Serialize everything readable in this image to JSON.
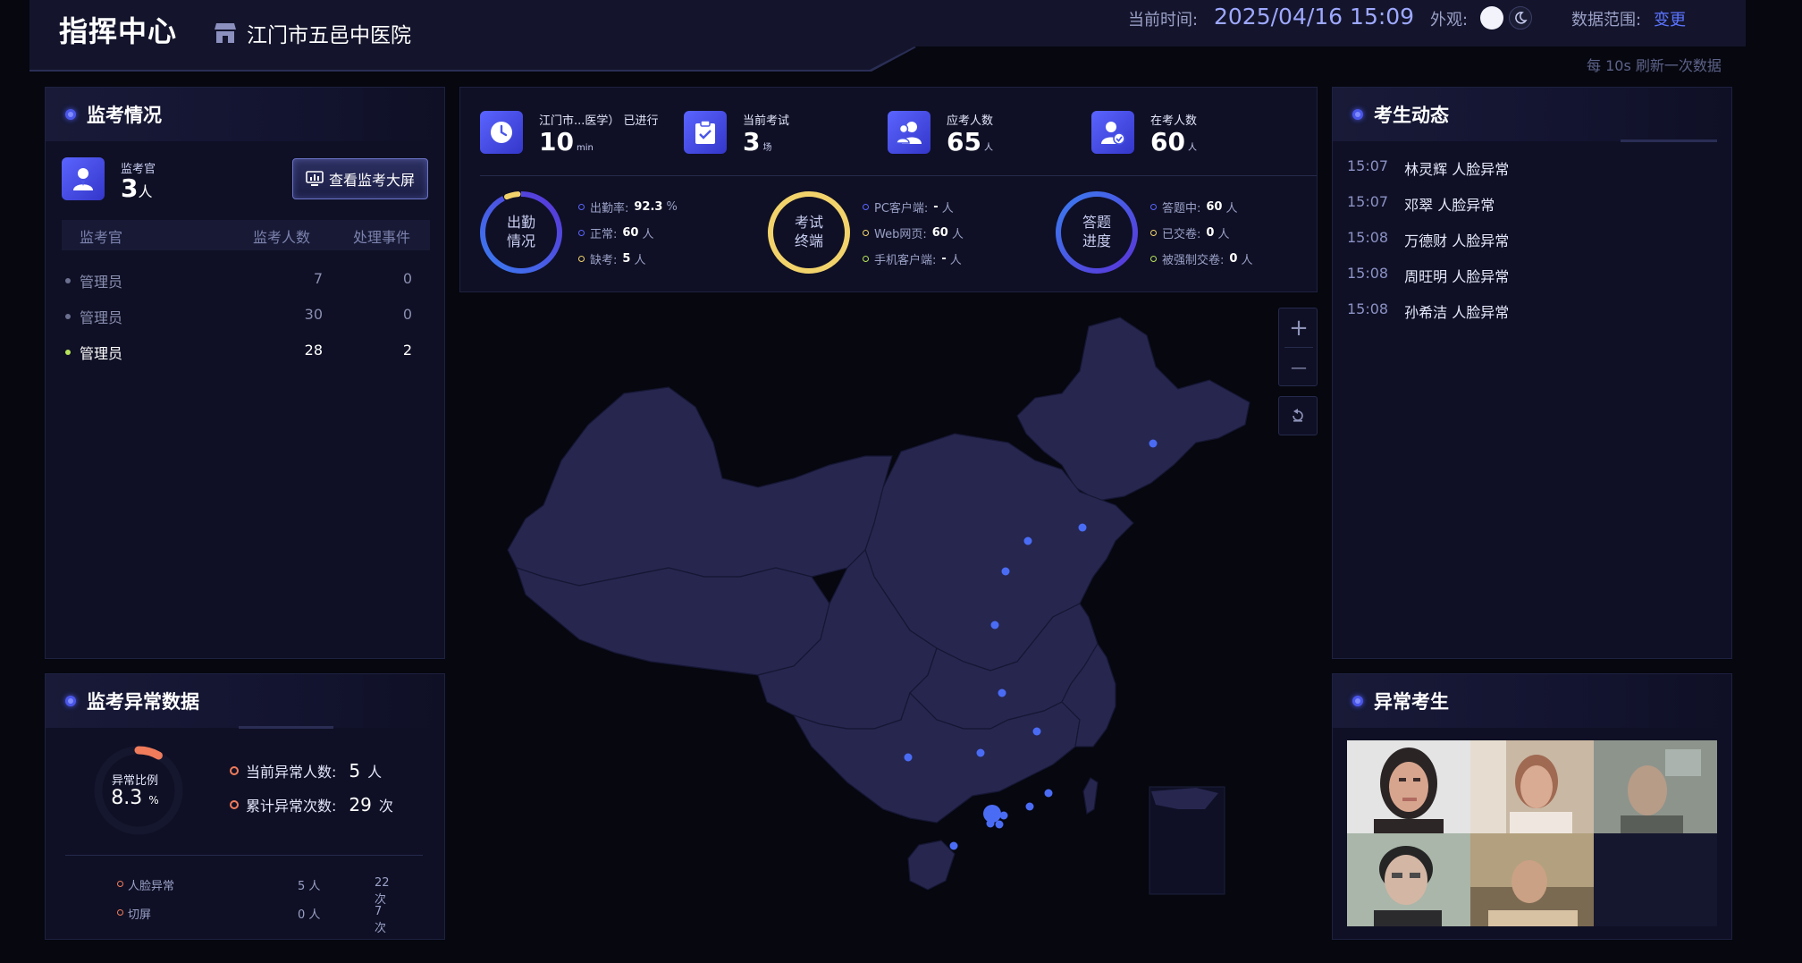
{
  "header": {
    "title": "指挥中心",
    "org_name": "江门市五邑中医院",
    "time_label": "当前时间:",
    "time_value": "2025/04/16 15:09",
    "appearance_label": "外观:",
    "data_scope_label": "数据范围:",
    "data_scope_link": "变更",
    "refresh_note": "每 10s 刷新一次数据",
    "icons": [
      "store-icon",
      "sun-icon",
      "moon-icon"
    ]
  },
  "supervision": {
    "title": "监考情况",
    "supervisor_label": "监考官",
    "supervisor_count": "3",
    "supervisor_unit": "人",
    "big_screen_button": "查看监考大屏",
    "columns": [
      "监考官",
      "监考人数",
      "处理事件"
    ],
    "rows": [
      {
        "name": "管理员",
        "count": "7",
        "events": "0",
        "active": false
      },
      {
        "name": "管理员",
        "count": "30",
        "events": "0",
        "active": false
      },
      {
        "name": "管理员",
        "count": "28",
        "events": "2",
        "active": true
      }
    ]
  },
  "center_stats": {
    "items": [
      {
        "label": "江门市...医学）  已进行",
        "value": "10",
        "unit": "min",
        "icon": "clock-icon"
      },
      {
        "label": "当前考试",
        "value": "3",
        "unit": "场",
        "icon": "clipboard-check-icon"
      },
      {
        "label": "应考人数",
        "value": "65",
        "unit": "人",
        "icon": "users-icon"
      },
      {
        "label": "在考人数",
        "value": "60",
        "unit": "人",
        "icon": "user-check-icon"
      }
    ],
    "attendance": {
      "label_line1": "出勤",
      "label_line2": "情况",
      "rate_label": "出勤率:",
      "rate_value": "92.3",
      "rate_unit": "%",
      "rate_fraction": 0.923,
      "normal_label": "正常:",
      "normal_value": "60",
      "normal_unit": "人",
      "absent_label": "缺考:",
      "absent_value": "5",
      "absent_unit": "人",
      "colors": {
        "main": "#4a56e8",
        "accent": "#f2d36b"
      }
    },
    "terminal": {
      "label_line1": "考试",
      "label_line2": "终端",
      "pc_label": "PC客户端:",
      "pc_value": "-",
      "pc_unit": "人",
      "web_label": "Web网页:",
      "web_value": "60",
      "web_unit": "人",
      "mobile_label": "手机客户端:",
      "mobile_value": "-",
      "mobile_unit": "人",
      "colors": {
        "main": "#f2d36b"
      }
    },
    "progress": {
      "label_line1": "答题",
      "label_line2": "进度",
      "answering_label": "答题中:",
      "answering_value": "60",
      "answering_unit": "人",
      "submitted_label": "已交卷:",
      "submitted_value": "0",
      "submitted_unit": "人",
      "forced_label": "被强制交卷:",
      "forced_value": "0",
      "forced_unit": "人",
      "colors": {
        "main": "#4a56e8",
        "accent": "#b6e35a"
      }
    }
  },
  "map_controls": {
    "zoom_in": "+",
    "zoom_out": "—"
  },
  "candidate_feed": {
    "title": "考生动态",
    "items": [
      {
        "time": "15:07",
        "text": "林灵辉 人脸异常"
      },
      {
        "time": "15:07",
        "text": "邓翠 人脸异常"
      },
      {
        "time": "15:08",
        "text": "万德财 人脸异常"
      },
      {
        "time": "15:08",
        "text": "周旺明 人脸异常"
      },
      {
        "time": "15:08",
        "text": "孙希洁 人脸异常"
      }
    ]
  },
  "anomaly_data": {
    "title": "监考异常数据",
    "ratio_label": "异常比例",
    "ratio_value": "8.3",
    "ratio_unit": "%",
    "ratio_fraction": 0.083,
    "current_label": "当前异常人数:",
    "current_value": "5",
    "current_unit": "人",
    "total_label": "累计异常次数:",
    "total_value": "29",
    "total_unit": "次",
    "rows": [
      {
        "type": "人脸异常",
        "people": "5 人",
        "times": "22 次"
      },
      {
        "type": "切屏",
        "people": "0 人",
        "times": "7 次"
      }
    ],
    "accent_color": "#f07c5c"
  },
  "abnormal_students": {
    "title": "异常考生",
    "photo_count": 5
  }
}
